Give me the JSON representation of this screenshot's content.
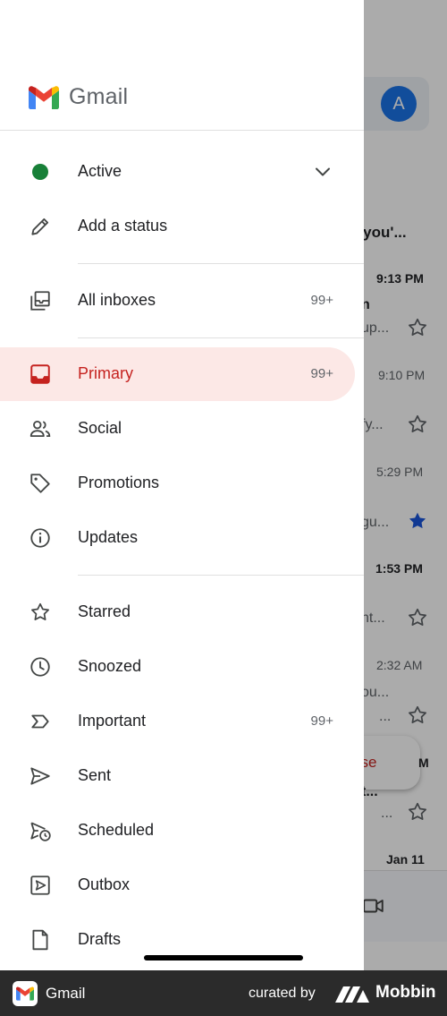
{
  "app": {
    "wordmark": "Gmail",
    "avatar_letter": "A"
  },
  "status": {
    "label": "Active",
    "add_label": "Add a status",
    "color": "#188038"
  },
  "drawer_items": [
    {
      "id": "all-inboxes",
      "label": "All inboxes",
      "count": "99+",
      "icon": "all-inboxes-icon"
    },
    {
      "id": "primary",
      "label": "Primary",
      "count": "99+",
      "icon": "inbox-icon",
      "selected": true
    },
    {
      "id": "social",
      "label": "Social",
      "icon": "people-icon"
    },
    {
      "id": "promotions",
      "label": "Promotions",
      "icon": "tag-icon"
    },
    {
      "id": "updates",
      "label": "Updates",
      "icon": "info-icon"
    },
    {
      "id": "starred",
      "label": "Starred",
      "icon": "star-icon"
    },
    {
      "id": "snoozed",
      "label": "Snoozed",
      "icon": "clock-icon"
    },
    {
      "id": "important",
      "label": "Important",
      "count": "99+",
      "icon": "important-icon"
    },
    {
      "id": "sent",
      "label": "Sent",
      "icon": "send-icon"
    },
    {
      "id": "scheduled",
      "label": "Scheduled",
      "icon": "scheduled-send-icon"
    },
    {
      "id": "outbox",
      "label": "Outbox",
      "icon": "outbox-icon"
    },
    {
      "id": "drafts",
      "label": "Drafts",
      "icon": "draft-icon"
    }
  ],
  "background_inbox": {
    "snippets": [
      "e you'...",
      "n",
      "up...",
      "fy...",
      "gu...",
      "nt...",
      "ou...",
      "...",
      "t...",
      "..."
    ],
    "times": [
      "9:13 PM",
      "9:10 PM",
      "5:29 PM",
      "1:53 PM",
      "2:32 AM",
      "M",
      "Jan 11"
    ],
    "compose_label": "ose"
  },
  "colors": {
    "selected_bg": "#fce8e6",
    "selected_text": "#c5221f",
    "starred_blue": "#1a56db"
  },
  "footer": {
    "app_name": "Gmail",
    "curated_by": "curated by",
    "brand": "Mobbin"
  }
}
